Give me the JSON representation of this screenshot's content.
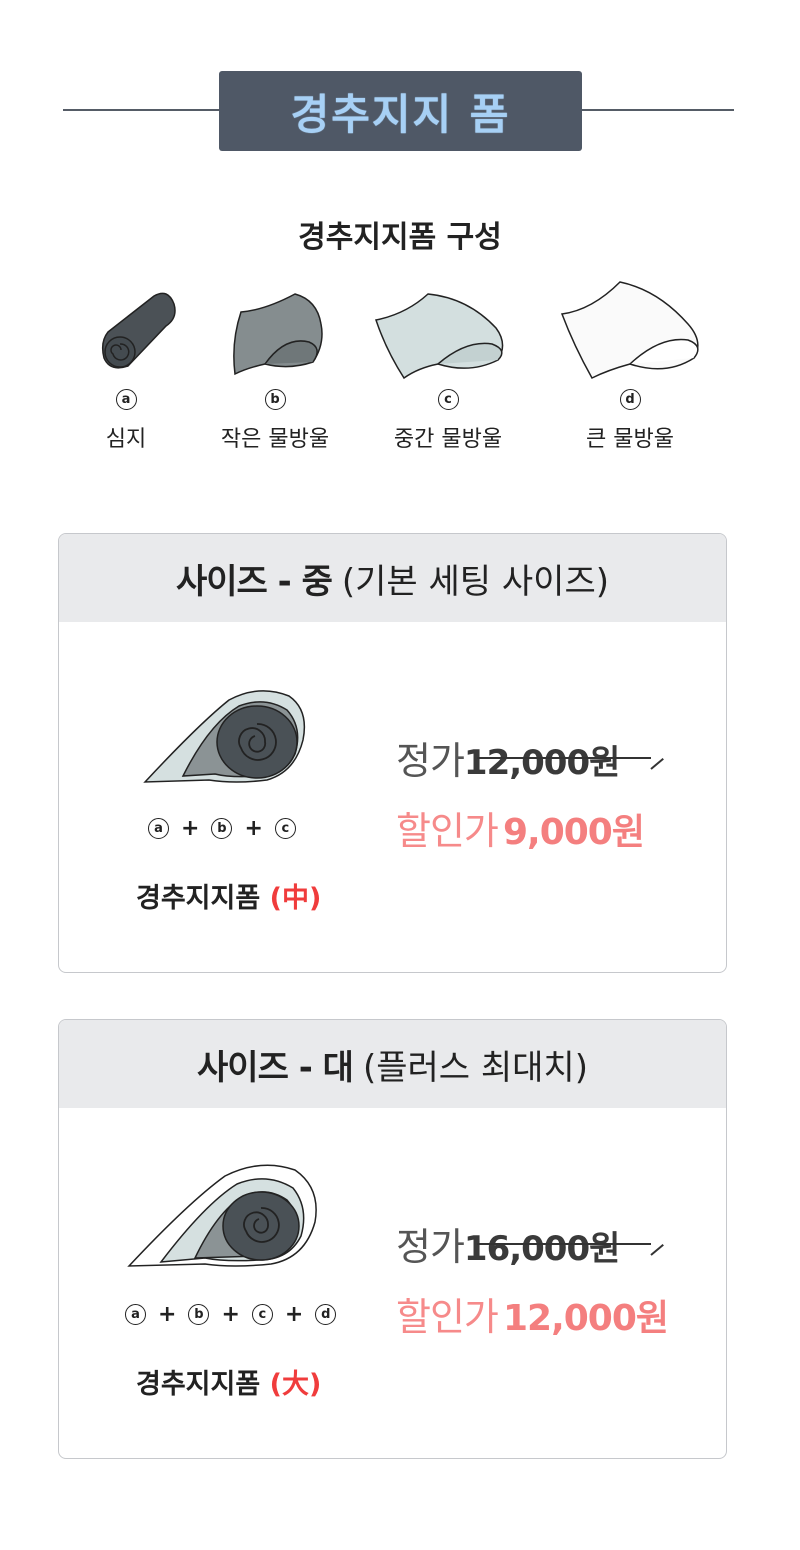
{
  "title": "경추지지 폼",
  "composition": {
    "heading": "경추지지폼 구성",
    "items": [
      {
        "badge": "a",
        "label": "심지",
        "color": "#4b5156"
      },
      {
        "badge": "b",
        "label": "작은 물방울",
        "color": "#858d8f"
      },
      {
        "badge": "c",
        "label": "중간 물방울",
        "color": "#d3dfdf"
      },
      {
        "badge": "d",
        "label": "큰 물방울",
        "color": "#fafafa"
      }
    ]
  },
  "sizes": [
    {
      "header_bold": "사이즈 - 중",
      "header_light": "(기본 세팅 사이즈)",
      "formula": [
        "a",
        "b",
        "c"
      ],
      "product_name": "경추지지폼",
      "product_size": "(中)",
      "regular_label": "정가",
      "regular_price": "12,000원",
      "sale_label": "할인가",
      "sale_price": "9,000원"
    },
    {
      "header_bold": "사이즈 - 대",
      "header_light": "(플러스 최대치)",
      "formula": [
        "a",
        "b",
        "c",
        "d"
      ],
      "product_name": "경추지지폼",
      "product_size": "(大)",
      "regular_label": "정가",
      "regular_price": "16,000원",
      "sale_label": "할인가",
      "sale_price": "12,000원"
    }
  ]
}
